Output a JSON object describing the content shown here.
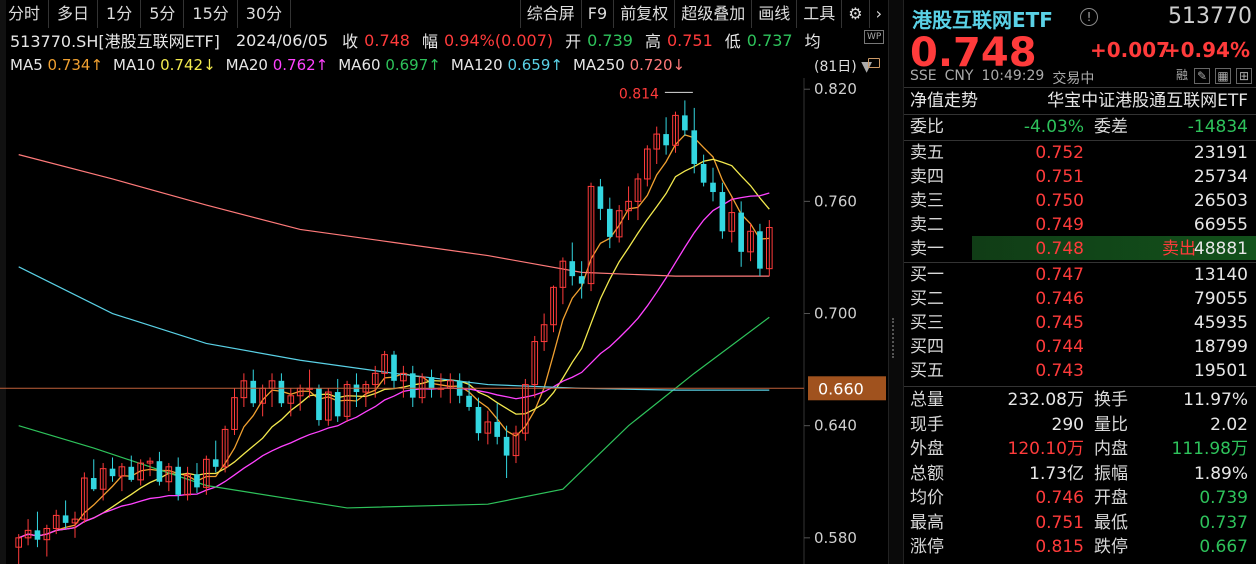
{
  "toolbar": {
    "left": [
      "分时",
      "多日",
      "1分",
      "5分",
      "15分",
      "30分"
    ],
    "right": [
      "综合屏",
      "F9",
      "前复权",
      "超级叠加",
      "画线",
      "工具"
    ],
    "gear": "⚙",
    "next": "›"
  },
  "info": {
    "symbol": "513770.SH[港股互联网ETF]",
    "date": "2024/06/05",
    "close_label": "收",
    "close": "0.748",
    "amp_label": "幅",
    "amp": "0.94%(0.007)",
    "open_label": "开",
    "open": "0.739",
    "high_label": "高",
    "high": "0.751",
    "low_label": "低",
    "low": "0.737",
    "avg_label": "均"
  },
  "ma": [
    {
      "label": "MA5",
      "value": "0.734↑",
      "color": "#f0a030"
    },
    {
      "label": "MA10",
      "value": "0.742↓",
      "color": "#f2e94e"
    },
    {
      "label": "MA20",
      "value": "0.762↑",
      "color": "#ff42ff"
    },
    {
      "label": "MA60",
      "value": "0.697↑",
      "color": "#2ec25b"
    },
    {
      "label": "MA120",
      "value": "0.659↑",
      "color": "#5ad1e6"
    },
    {
      "label": "MA250",
      "value": "0.720↓",
      "color": "#ff7a7a"
    }
  ],
  "period": "(81日)",
  "wp_badge": "WP",
  "chart_data": {
    "type": "candlestick",
    "yaxis_ticks": [
      "0.820",
      "0.760",
      "0.700",
      "0.640",
      "0.580"
    ],
    "ylim": [
      0.566,
      0.826
    ],
    "current_price_label": "0.660",
    "max_label": "0.814",
    "candles": [
      [
        0.575,
        0.582,
        0.566,
        0.58
      ],
      [
        0.58,
        0.59,
        0.576,
        0.584
      ],
      [
        0.584,
        0.594,
        0.575,
        0.579
      ],
      [
        0.579,
        0.587,
        0.57,
        0.585
      ],
      [
        0.585,
        0.595,
        0.582,
        0.592
      ],
      [
        0.592,
        0.6,
        0.585,
        0.588
      ],
      [
        0.588,
        0.594,
        0.58,
        0.59
      ],
      [
        0.59,
        0.615,
        0.588,
        0.612
      ],
      [
        0.612,
        0.622,
        0.605,
        0.606
      ],
      [
        0.606,
        0.62,
        0.6,
        0.617
      ],
      [
        0.617,
        0.623,
        0.61,
        0.613
      ],
      [
        0.613,
        0.62,
        0.605,
        0.618
      ],
      [
        0.618,
        0.624,
        0.61,
        0.611
      ],
      [
        0.611,
        0.622,
        0.608,
        0.62
      ],
      [
        0.62,
        0.623,
        0.613,
        0.621
      ],
      [
        0.621,
        0.626,
        0.608,
        0.61
      ],
      [
        0.61,
        0.62,
        0.605,
        0.618
      ],
      [
        0.618,
        0.623,
        0.6,
        0.603
      ],
      [
        0.603,
        0.618,
        0.6,
        0.614
      ],
      [
        0.614,
        0.62,
        0.604,
        0.607
      ],
      [
        0.607,
        0.624,
        0.603,
        0.622
      ],
      [
        0.622,
        0.632,
        0.615,
        0.618
      ],
      [
        0.618,
        0.64,
        0.615,
        0.638
      ],
      [
        0.638,
        0.66,
        0.635,
        0.655
      ],
      [
        0.655,
        0.668,
        0.65,
        0.664
      ],
      [
        0.664,
        0.67,
        0.65,
        0.652
      ],
      [
        0.652,
        0.662,
        0.645,
        0.66
      ],
      [
        0.66,
        0.668,
        0.65,
        0.664
      ],
      [
        0.664,
        0.668,
        0.65,
        0.652
      ],
      [
        0.652,
        0.66,
        0.645,
        0.656
      ],
      [
        0.656,
        0.662,
        0.648,
        0.66
      ],
      [
        0.66,
        0.67,
        0.655,
        0.66
      ],
      [
        0.66,
        0.662,
        0.64,
        0.643
      ],
      [
        0.643,
        0.66,
        0.64,
        0.658
      ],
      [
        0.658,
        0.665,
        0.642,
        0.645
      ],
      [
        0.645,
        0.664,
        0.642,
        0.662
      ],
      [
        0.662,
        0.668,
        0.65,
        0.658
      ],
      [
        0.658,
        0.664,
        0.65,
        0.662
      ],
      [
        0.662,
        0.672,
        0.655,
        0.668
      ],
      [
        0.668,
        0.68,
        0.662,
        0.678
      ],
      [
        0.678,
        0.68,
        0.66,
        0.664
      ],
      [
        0.664,
        0.672,
        0.655,
        0.668
      ],
      [
        0.668,
        0.672,
        0.65,
        0.655
      ],
      [
        0.655,
        0.668,
        0.652,
        0.666
      ],
      [
        0.666,
        0.67,
        0.655,
        0.66
      ],
      [
        0.66,
        0.668,
        0.655,
        0.66
      ],
      [
        0.66,
        0.668,
        0.652,
        0.664
      ],
      [
        0.664,
        0.668,
        0.652,
        0.656
      ],
      [
        0.656,
        0.664,
        0.648,
        0.65
      ],
      [
        0.65,
        0.655,
        0.632,
        0.636
      ],
      [
        0.636,
        0.648,
        0.63,
        0.642
      ],
      [
        0.642,
        0.652,
        0.63,
        0.634
      ],
      [
        0.634,
        0.64,
        0.612,
        0.624
      ],
      [
        0.624,
        0.64,
        0.62,
        0.636
      ],
      [
        0.636,
        0.665,
        0.632,
        0.662
      ],
      [
        0.662,
        0.688,
        0.655,
        0.685
      ],
      [
        0.685,
        0.7,
        0.68,
        0.694
      ],
      [
        0.694,
        0.715,
        0.69,
        0.714
      ],
      [
        0.714,
        0.73,
        0.705,
        0.728
      ],
      [
        0.728,
        0.738,
        0.715,
        0.72
      ],
      [
        0.72,
        0.728,
        0.708,
        0.716
      ],
      [
        0.716,
        0.77,
        0.712,
        0.768
      ],
      [
        0.768,
        0.772,
        0.75,
        0.756
      ],
      [
        0.756,
        0.762,
        0.735,
        0.741
      ],
      [
        0.741,
        0.758,
        0.738,
        0.755
      ],
      [
        0.755,
        0.768,
        0.75,
        0.76
      ],
      [
        0.76,
        0.775,
        0.75,
        0.772
      ],
      [
        0.772,
        0.79,
        0.768,
        0.788
      ],
      [
        0.788,
        0.8,
        0.78,
        0.796
      ],
      [
        0.796,
        0.805,
        0.785,
        0.79
      ],
      [
        0.79,
        0.808,
        0.786,
        0.806
      ],
      [
        0.806,
        0.814,
        0.795,
        0.798
      ],
      [
        0.798,
        0.81,
        0.775,
        0.78
      ],
      [
        0.78,
        0.785,
        0.768,
        0.77
      ],
      [
        0.77,
        0.778,
        0.76,
        0.765
      ],
      [
        0.765,
        0.77,
        0.74,
        0.744
      ],
      [
        0.744,
        0.762,
        0.738,
        0.754
      ],
      [
        0.754,
        0.76,
        0.725,
        0.733
      ],
      [
        0.733,
        0.748,
        0.728,
        0.744
      ],
      [
        0.744,
        0.748,
        0.72,
        0.724
      ],
      [
        0.724,
        0.75,
        0.72,
        0.746
      ]
    ]
  },
  "panel": {
    "name": "港股互联网ETF",
    "info_icon": "!",
    "code": "513770",
    "price": "0.748",
    "change": "+0.007",
    "change_pct": "+0.94%",
    "meta": [
      "SSE",
      "CNY",
      "10:49:29",
      "交易中"
    ],
    "icons": [
      "融",
      "✎",
      "▦",
      "⊞"
    ],
    "nav_label": "净值走势",
    "nav_name": "华宝中证港股通互联网ETF",
    "ratio": {
      "l1": "委比",
      "v1": "-4.03%",
      "l2": "委差",
      "v2": "-14834"
    },
    "asks": [
      {
        "label": "卖五",
        "price": "0.752",
        "vol": "23191"
      },
      {
        "label": "卖四",
        "price": "0.751",
        "vol": "25734"
      },
      {
        "label": "卖三",
        "price": "0.750",
        "vol": "26503"
      },
      {
        "label": "卖二",
        "price": "0.749",
        "vol": "66955"
      },
      {
        "label": "卖一",
        "price": "0.748",
        "vol": "48881",
        "tag": "卖出"
      }
    ],
    "bids": [
      {
        "label": "买一",
        "price": "0.747",
        "vol": "13140"
      },
      {
        "label": "买二",
        "price": "0.746",
        "vol": "79055"
      },
      {
        "label": "买三",
        "price": "0.745",
        "vol": "45935"
      },
      {
        "label": "买四",
        "price": "0.744",
        "vol": "18799"
      },
      {
        "label": "买五",
        "price": "0.743",
        "vol": "19501"
      }
    ],
    "stats": [
      {
        "l1": "总量",
        "v1": "232.08万",
        "c1": "wh",
        "l2": "换手",
        "v2": "11.97%",
        "c2": "wh"
      },
      {
        "l1": "现手",
        "v1": "290",
        "c1": "wh",
        "l2": "量比",
        "v2": "2.02",
        "c2": "wh"
      },
      {
        "l1": "外盘",
        "v1": "120.10万",
        "c1": "up",
        "l2": "内盘",
        "v2": "111.98万",
        "c2": "dn"
      },
      {
        "l1": "总额",
        "v1": "1.73亿",
        "c1": "wh",
        "l2": "振幅",
        "v2": "1.89%",
        "c2": "wh"
      },
      {
        "l1": "均价",
        "v1": "0.746",
        "c1": "up",
        "l2": "开盘",
        "v2": "0.739",
        "c2": "dn"
      },
      {
        "l1": "最高",
        "v1": "0.751",
        "c1": "up",
        "l2": "最低",
        "v2": "0.737",
        "c2": "dn"
      },
      {
        "l1": "涨停",
        "v1": "0.815",
        "c1": "up",
        "l2": "跌停",
        "v2": "0.667",
        "c2": "dn"
      }
    ]
  }
}
